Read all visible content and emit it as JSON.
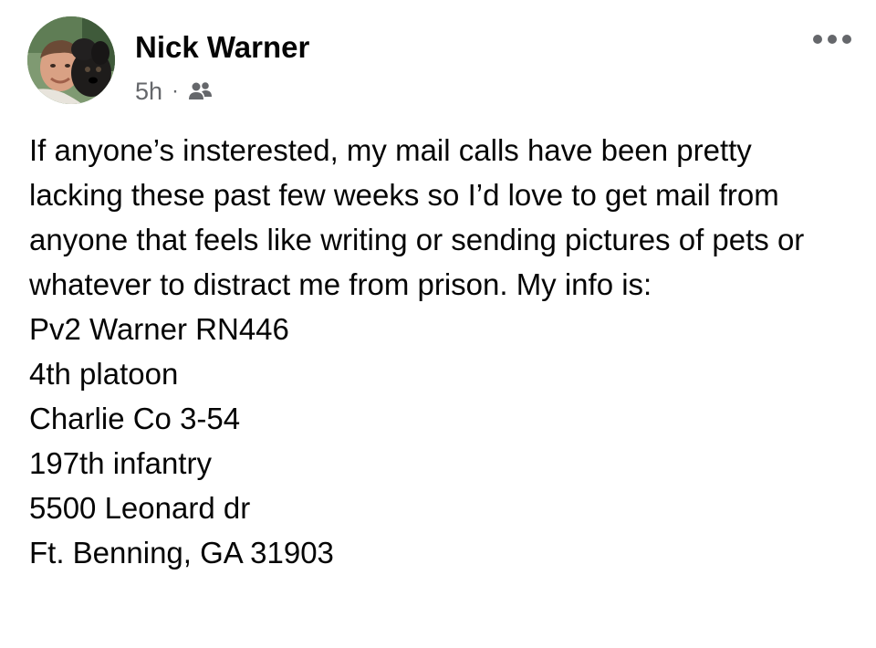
{
  "post": {
    "author": "Nick Warner",
    "time": "5h",
    "separator": "·",
    "audience_icon": "friends-icon",
    "more_icon": "more-options-icon",
    "body_intro": "If anyone’s insterested, my mail calls have been pretty lacking these past few weeks so I’d love to get mail from anyone that feels like writing or sending pictures of pets or whatever to distract me from prison. My info is:",
    "address": [
      "Pv2 Warner RN446",
      "4th platoon",
      "Charlie Co 3-54",
      "197th infantry",
      "5500 Leonard dr",
      "Ft. Benning, GA 31903"
    ]
  },
  "colors": {
    "text": "#050505",
    "secondary_text": "#65676b",
    "background": "#ffffff"
  }
}
